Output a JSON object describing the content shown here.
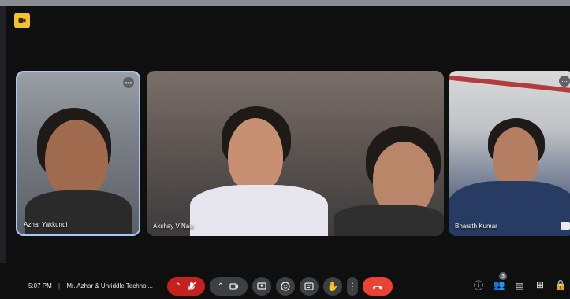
{
  "meeting": {
    "time": "5:07 PM",
    "separator": "|",
    "title": "Mr. Azhar & Unriddle Technol..."
  },
  "participants": [
    {
      "name": "Azhar Yakkundi"
    },
    {
      "name": "Akshay V Naik"
    },
    {
      "name": "Bharath Kumar"
    }
  ],
  "controls": {
    "count_people": "3"
  },
  "colors": {
    "accent": "#a8c7fa",
    "hangup": "#ea4335",
    "mic_off": "#c5221f",
    "badge": "#f2c230"
  }
}
